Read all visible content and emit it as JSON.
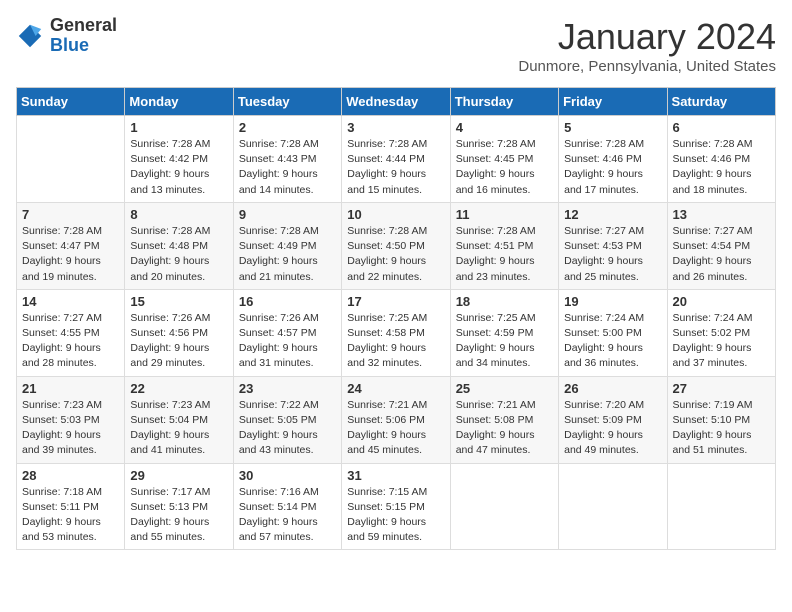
{
  "header": {
    "logo_general": "General",
    "logo_blue": "Blue",
    "title": "January 2024",
    "location": "Dunmore, Pennsylvania, United States"
  },
  "weekdays": [
    "Sunday",
    "Monday",
    "Tuesday",
    "Wednesday",
    "Thursday",
    "Friday",
    "Saturday"
  ],
  "weeks": [
    [
      {
        "day": "",
        "sunrise": "",
        "sunset": "",
        "daylight": ""
      },
      {
        "day": "1",
        "sunrise": "Sunrise: 7:28 AM",
        "sunset": "Sunset: 4:42 PM",
        "daylight": "Daylight: 9 hours and 13 minutes."
      },
      {
        "day": "2",
        "sunrise": "Sunrise: 7:28 AM",
        "sunset": "Sunset: 4:43 PM",
        "daylight": "Daylight: 9 hours and 14 minutes."
      },
      {
        "day": "3",
        "sunrise": "Sunrise: 7:28 AM",
        "sunset": "Sunset: 4:44 PM",
        "daylight": "Daylight: 9 hours and 15 minutes."
      },
      {
        "day": "4",
        "sunrise": "Sunrise: 7:28 AM",
        "sunset": "Sunset: 4:45 PM",
        "daylight": "Daylight: 9 hours and 16 minutes."
      },
      {
        "day": "5",
        "sunrise": "Sunrise: 7:28 AM",
        "sunset": "Sunset: 4:46 PM",
        "daylight": "Daylight: 9 hours and 17 minutes."
      },
      {
        "day": "6",
        "sunrise": "Sunrise: 7:28 AM",
        "sunset": "Sunset: 4:46 PM",
        "daylight": "Daylight: 9 hours and 18 minutes."
      }
    ],
    [
      {
        "day": "7",
        "sunrise": "Sunrise: 7:28 AM",
        "sunset": "Sunset: 4:47 PM",
        "daylight": "Daylight: 9 hours and 19 minutes."
      },
      {
        "day": "8",
        "sunrise": "Sunrise: 7:28 AM",
        "sunset": "Sunset: 4:48 PM",
        "daylight": "Daylight: 9 hours and 20 minutes."
      },
      {
        "day": "9",
        "sunrise": "Sunrise: 7:28 AM",
        "sunset": "Sunset: 4:49 PM",
        "daylight": "Daylight: 9 hours and 21 minutes."
      },
      {
        "day": "10",
        "sunrise": "Sunrise: 7:28 AM",
        "sunset": "Sunset: 4:50 PM",
        "daylight": "Daylight: 9 hours and 22 minutes."
      },
      {
        "day": "11",
        "sunrise": "Sunrise: 7:28 AM",
        "sunset": "Sunset: 4:51 PM",
        "daylight": "Daylight: 9 hours and 23 minutes."
      },
      {
        "day": "12",
        "sunrise": "Sunrise: 7:27 AM",
        "sunset": "Sunset: 4:53 PM",
        "daylight": "Daylight: 9 hours and 25 minutes."
      },
      {
        "day": "13",
        "sunrise": "Sunrise: 7:27 AM",
        "sunset": "Sunset: 4:54 PM",
        "daylight": "Daylight: 9 hours and 26 minutes."
      }
    ],
    [
      {
        "day": "14",
        "sunrise": "Sunrise: 7:27 AM",
        "sunset": "Sunset: 4:55 PM",
        "daylight": "Daylight: 9 hours and 28 minutes."
      },
      {
        "day": "15",
        "sunrise": "Sunrise: 7:26 AM",
        "sunset": "Sunset: 4:56 PM",
        "daylight": "Daylight: 9 hours and 29 minutes."
      },
      {
        "day": "16",
        "sunrise": "Sunrise: 7:26 AM",
        "sunset": "Sunset: 4:57 PM",
        "daylight": "Daylight: 9 hours and 31 minutes."
      },
      {
        "day": "17",
        "sunrise": "Sunrise: 7:25 AM",
        "sunset": "Sunset: 4:58 PM",
        "daylight": "Daylight: 9 hours and 32 minutes."
      },
      {
        "day": "18",
        "sunrise": "Sunrise: 7:25 AM",
        "sunset": "Sunset: 4:59 PM",
        "daylight": "Daylight: 9 hours and 34 minutes."
      },
      {
        "day": "19",
        "sunrise": "Sunrise: 7:24 AM",
        "sunset": "Sunset: 5:00 PM",
        "daylight": "Daylight: 9 hours and 36 minutes."
      },
      {
        "day": "20",
        "sunrise": "Sunrise: 7:24 AM",
        "sunset": "Sunset: 5:02 PM",
        "daylight": "Daylight: 9 hours and 37 minutes."
      }
    ],
    [
      {
        "day": "21",
        "sunrise": "Sunrise: 7:23 AM",
        "sunset": "Sunset: 5:03 PM",
        "daylight": "Daylight: 9 hours and 39 minutes."
      },
      {
        "day": "22",
        "sunrise": "Sunrise: 7:23 AM",
        "sunset": "Sunset: 5:04 PM",
        "daylight": "Daylight: 9 hours and 41 minutes."
      },
      {
        "day": "23",
        "sunrise": "Sunrise: 7:22 AM",
        "sunset": "Sunset: 5:05 PM",
        "daylight": "Daylight: 9 hours and 43 minutes."
      },
      {
        "day": "24",
        "sunrise": "Sunrise: 7:21 AM",
        "sunset": "Sunset: 5:06 PM",
        "daylight": "Daylight: 9 hours and 45 minutes."
      },
      {
        "day": "25",
        "sunrise": "Sunrise: 7:21 AM",
        "sunset": "Sunset: 5:08 PM",
        "daylight": "Daylight: 9 hours and 47 minutes."
      },
      {
        "day": "26",
        "sunrise": "Sunrise: 7:20 AM",
        "sunset": "Sunset: 5:09 PM",
        "daylight": "Daylight: 9 hours and 49 minutes."
      },
      {
        "day": "27",
        "sunrise": "Sunrise: 7:19 AM",
        "sunset": "Sunset: 5:10 PM",
        "daylight": "Daylight: 9 hours and 51 minutes."
      }
    ],
    [
      {
        "day": "28",
        "sunrise": "Sunrise: 7:18 AM",
        "sunset": "Sunset: 5:11 PM",
        "daylight": "Daylight: 9 hours and 53 minutes."
      },
      {
        "day": "29",
        "sunrise": "Sunrise: 7:17 AM",
        "sunset": "Sunset: 5:13 PM",
        "daylight": "Daylight: 9 hours and 55 minutes."
      },
      {
        "day": "30",
        "sunrise": "Sunrise: 7:16 AM",
        "sunset": "Sunset: 5:14 PM",
        "daylight": "Daylight: 9 hours and 57 minutes."
      },
      {
        "day": "31",
        "sunrise": "Sunrise: 7:15 AM",
        "sunset": "Sunset: 5:15 PM",
        "daylight": "Daylight: 9 hours and 59 minutes."
      },
      {
        "day": "",
        "sunrise": "",
        "sunset": "",
        "daylight": ""
      },
      {
        "day": "",
        "sunrise": "",
        "sunset": "",
        "daylight": ""
      },
      {
        "day": "",
        "sunrise": "",
        "sunset": "",
        "daylight": ""
      }
    ]
  ]
}
